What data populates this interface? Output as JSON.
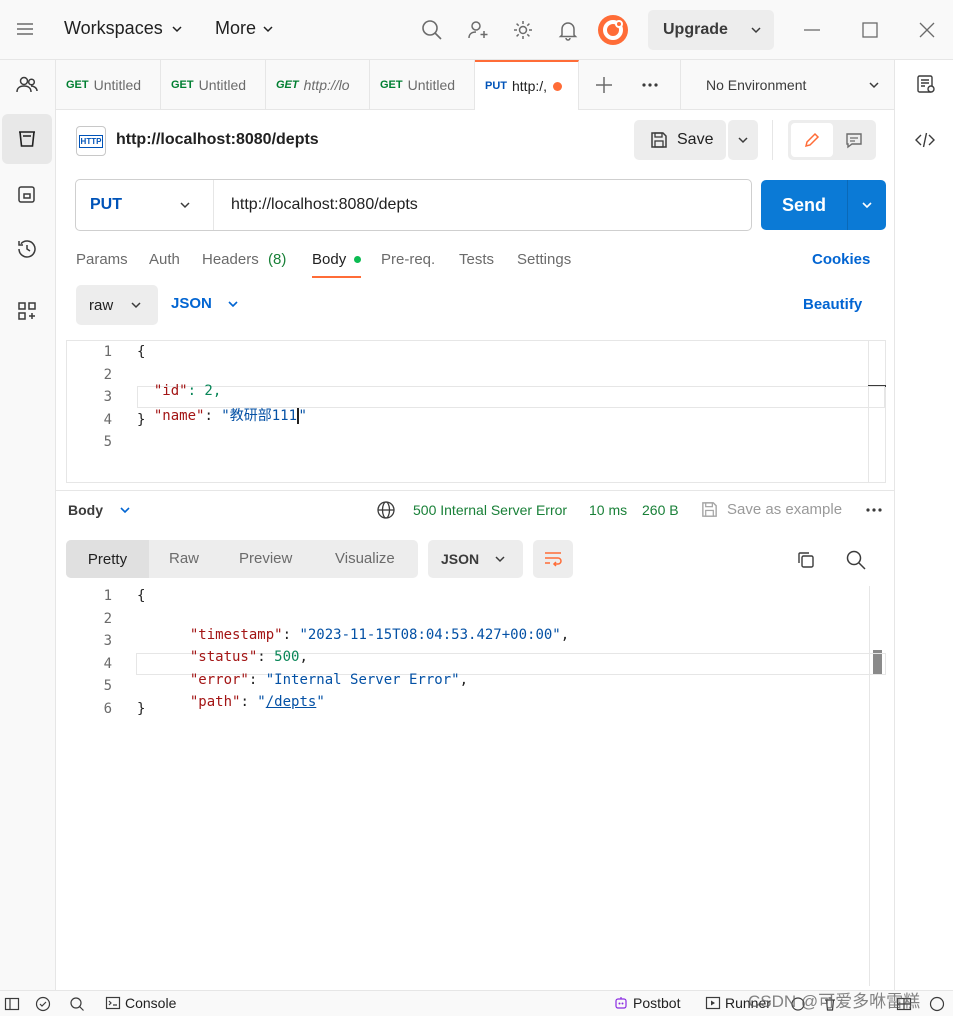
{
  "topbar": {
    "workspaces": "Workspaces",
    "more": "More",
    "upgrade": "Upgrade"
  },
  "tabs": [
    {
      "method": "GET",
      "label": "Untitled"
    },
    {
      "method": "GET",
      "label": "Untitled"
    },
    {
      "method": "GET",
      "label": "http://lo"
    },
    {
      "method": "GET",
      "label": "Untitled"
    },
    {
      "method": "PUT",
      "label": "http:/,"
    }
  ],
  "environment": "No Environment",
  "request": {
    "badge": "HTTP",
    "title": "http://localhost:8080/depts",
    "save": "Save",
    "method": "PUT",
    "url": "http://localhost:8080/depts",
    "send": "Send",
    "subtabs": [
      "Params",
      "Auth",
      "Headers",
      "(8)",
      "Body",
      "Pre-req.",
      "Tests",
      "Settings"
    ],
    "cookies": "Cookies",
    "body_mode": "raw",
    "body_lang": "JSON",
    "beautify": "Beautify",
    "body_lines": [
      "1",
      "2",
      "3",
      "4",
      "5"
    ],
    "body_code": {
      "l1": "{",
      "l2_key": "\"id\"",
      "l2_rest": ": 2,",
      "l3_key": "\"name\"",
      "l3_colon": ": ",
      "l3_val": "\"教研部111",
      "l3_end": "\"",
      "l4": "}"
    }
  },
  "response": {
    "label": "Body",
    "status": "500 Internal Server Error",
    "time": "10 ms",
    "size": "260 B",
    "save_example": "Save as example",
    "views": [
      "Pretty",
      "Raw",
      "Preview",
      "Visualize"
    ],
    "lang": "JSON",
    "lines": [
      "1",
      "2",
      "3",
      "4",
      "5",
      "6"
    ],
    "code": {
      "l1": "{",
      "timestamp_key": "\"timestamp\"",
      "timestamp_val": "\"2023-11-15T08:04:53.427+00:00\"",
      "status_key": "\"status\"",
      "status_val": "500",
      "error_key": "\"error\"",
      "error_val": "\"Internal Server Error\"",
      "path_key": "\"path\"",
      "path_q1": "\"",
      "path_val": "/depts",
      "path_q2": "\"",
      "l6": "}"
    }
  },
  "statusbar": {
    "console": "Console",
    "postbot": "Postbot",
    "runner": "Runner",
    "watermark": "CSDN @可爱多咻雷糕"
  },
  "colors": {
    "accent": "#ff6c37",
    "send": "#0b7ad6",
    "link": "#0265d2",
    "error": "#198038",
    "dot": "#0cbb52"
  }
}
